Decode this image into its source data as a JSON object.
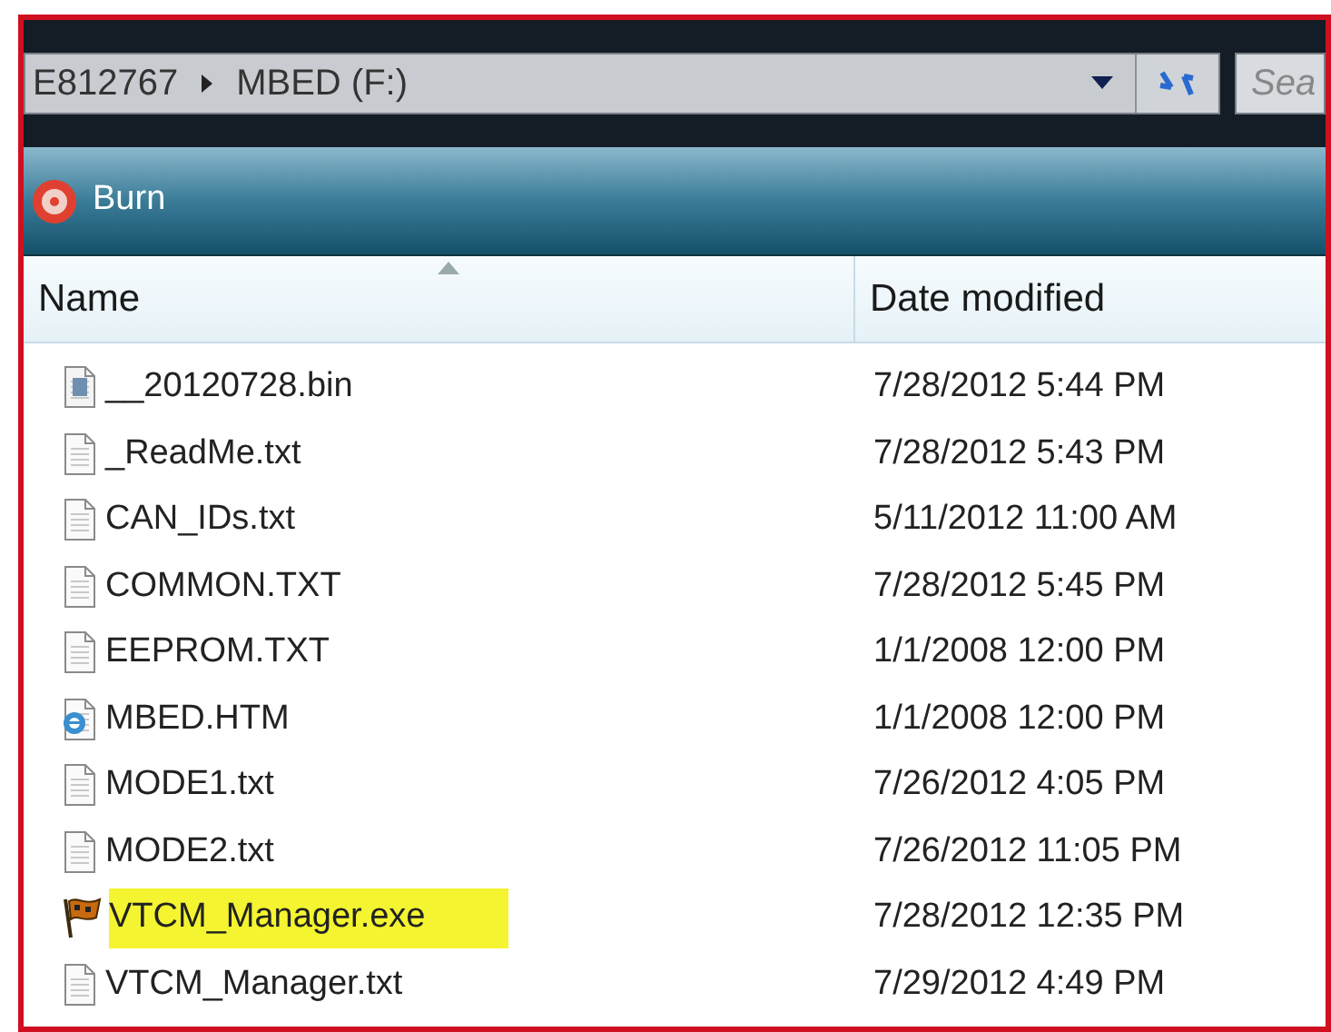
{
  "address_bar": {
    "path": [
      "E812767",
      "MBED (F:)"
    ]
  },
  "search": {
    "placeholder": "Sea"
  },
  "toolbar": {
    "items": [
      {
        "label": "Burn"
      }
    ]
  },
  "table": {
    "columns": [
      {
        "label": "Name",
        "sorted": true
      },
      {
        "label": "Date modified",
        "sorted": false
      }
    ],
    "rows": [
      {
        "kind": "bin",
        "name": "__20120728.bin",
        "date": "7/28/2012 5:44 PM",
        "highlighted": false
      },
      {
        "kind": "text",
        "name": "_ReadMe.txt",
        "date": "7/28/2012 5:43 PM",
        "highlighted": false
      },
      {
        "kind": "text",
        "name": "CAN_IDs.txt",
        "date": "5/11/2012 11:00 AM",
        "highlighted": false
      },
      {
        "kind": "text",
        "name": "COMMON.TXT",
        "date": "7/28/2012 5:45 PM",
        "highlighted": false
      },
      {
        "kind": "text",
        "name": "EEPROM.TXT",
        "date": "1/1/2008 12:00 PM",
        "highlighted": false
      },
      {
        "kind": "web",
        "name": "MBED.HTM",
        "date": "1/1/2008 12:00 PM",
        "highlighted": false
      },
      {
        "kind": "text",
        "name": "MODE1.txt",
        "date": "7/26/2012 4:05 PM",
        "highlighted": false
      },
      {
        "kind": "text",
        "name": "MODE2.txt",
        "date": "7/26/2012 11:05 PM",
        "highlighted": false
      },
      {
        "kind": "exe",
        "name": "VTCM_Manager.exe",
        "date": "7/28/2012 12:35 PM",
        "highlighted": true
      },
      {
        "kind": "text",
        "name": "VTCM_Manager.txt",
        "date": "7/29/2012 4:49 PM",
        "highlighted": false
      }
    ]
  }
}
